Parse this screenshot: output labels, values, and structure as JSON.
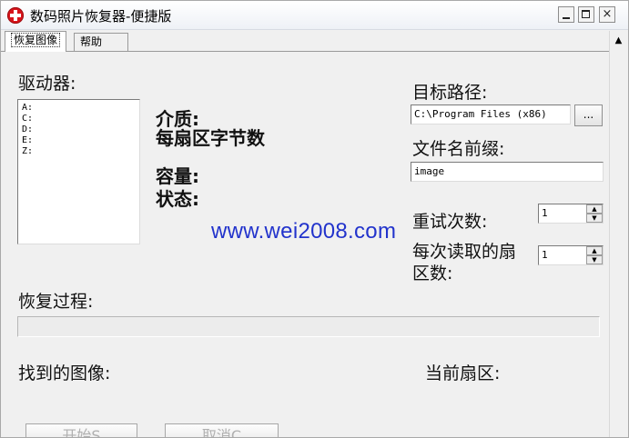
{
  "window": {
    "title": "数码照片恢复器-便捷版",
    "controls": {
      "minimize": "minimize",
      "maximize": "maximize",
      "close": "×"
    }
  },
  "tabs": [
    {
      "label": "恢复图像",
      "active": true
    },
    {
      "label": "帮助",
      "active": false
    }
  ],
  "drives": {
    "label": "驱动器:",
    "items": [
      "A:",
      "C:",
      "D:",
      "E:",
      "Z:"
    ]
  },
  "info": {
    "media": "介质:",
    "bytes_per_sector": "每扇区字节数",
    "capacity": "容量:",
    "status": "状态:"
  },
  "target": {
    "label": "目标路径:",
    "value": "C:\\Program Files (x86)",
    "browse_label": "..."
  },
  "prefix": {
    "label": "文件名前缀:",
    "value": "image"
  },
  "retries": {
    "label": "重试次数:",
    "value": "1"
  },
  "sectors_per_read": {
    "label": "每次读取的扇区数:",
    "value": "1"
  },
  "progress": {
    "label": "恢复过程:",
    "value": 0
  },
  "found": {
    "label": "找到的图像:"
  },
  "current_sector": {
    "label": "当前扇区:"
  },
  "buttons": {
    "start": "开始S",
    "cancel": "取消C"
  },
  "watermark": "www.wei2008.com",
  "colors": {
    "watermark": "#2233cc",
    "icon": "#d8141b"
  }
}
